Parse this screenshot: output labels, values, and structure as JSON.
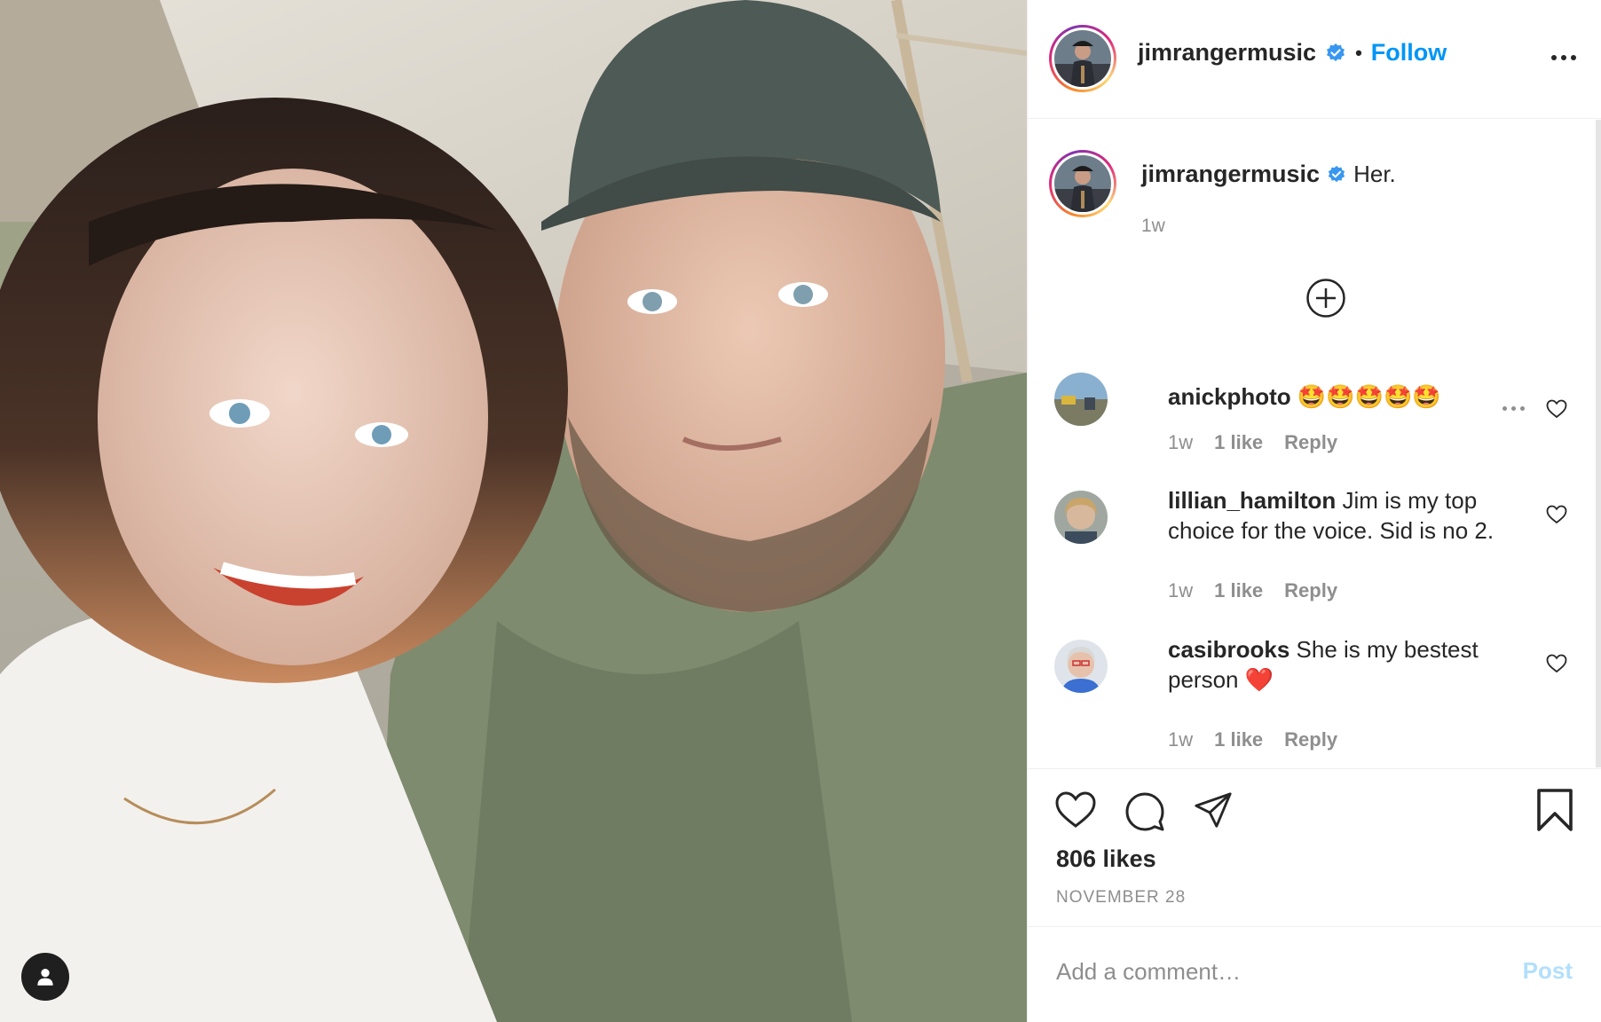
{
  "post": {
    "author": "jimrangermusic",
    "follow_label": "Follow",
    "separator": "•",
    "caption_text": "Her.",
    "caption_time": "1w",
    "likes": "806 likes",
    "date": "NOVEMBER 28"
  },
  "comments": [
    {
      "username": "anickphoto",
      "text": "🤩🤩🤩🤩🤩",
      "time": "1w",
      "likes": "1 like",
      "reply": "Reply"
    },
    {
      "username": "lillian_hamilton",
      "text": "Jim is my top choice for the voice. Sid is no 2.",
      "time": "1w",
      "likes": "1 like",
      "reply": "Reply"
    },
    {
      "username": "casibrooks",
      "text": "She is my bestest person ❤️",
      "time": "1w",
      "likes": "1 like",
      "reply": "Reply"
    }
  ],
  "add_comment": {
    "placeholder": "Add a comment…",
    "post_label": "Post"
  },
  "colors": {
    "accent": "#0095f6",
    "text": "#262626",
    "muted": "#8e8e8e",
    "post_disabled": "#b2dffc"
  },
  "icons": [
    "verified-icon",
    "more-icon",
    "add-circle-icon",
    "heart-icon",
    "comment-icon",
    "share-icon",
    "bookmark-icon",
    "user-tag-icon"
  ]
}
